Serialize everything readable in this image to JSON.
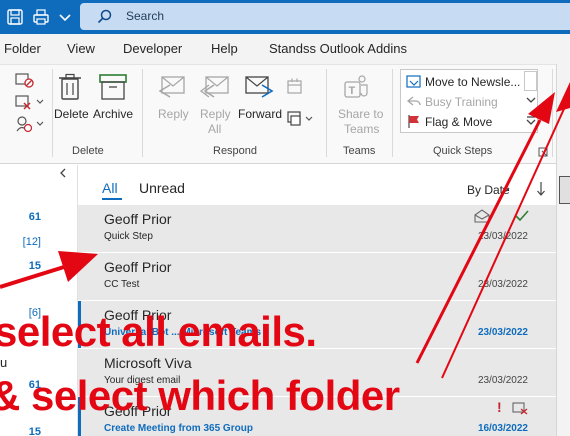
{
  "search": {
    "placeholder": "Search"
  },
  "menu": [
    "Folder",
    "View",
    "Developer",
    "Help",
    "Standss Outlook Addins"
  ],
  "ribbon": {
    "delete_group": {
      "label": "Delete",
      "delete": "Delete",
      "archive": "Archive"
    },
    "respond_group": {
      "label": "Respond",
      "reply": "Reply",
      "reply_all_1": "Reply",
      "reply_all_2": "All",
      "forward": "Forward"
    },
    "teams_group": {
      "label": "Teams",
      "share_1": "Share to",
      "share_2": "Teams"
    },
    "quicksteps_group": {
      "label": "Quick Steps",
      "items": [
        "Move to Newsle...",
        "Busy Training",
        "Flag & Move"
      ]
    }
  },
  "folders": {
    "counts": [
      "61",
      "[12]",
      "15",
      "[6]",
      "u",
      "61",
      "15"
    ]
  },
  "list": {
    "tabs": [
      "All",
      "Unread"
    ],
    "sort": "By Date",
    "messages": [
      {
        "from": "Geoff Prior",
        "subject": "Quick Step",
        "date": "23/03/2022"
      },
      {
        "from": "Geoff Prior",
        "subject": "CC Test",
        "date": "23/03/2022"
      },
      {
        "from": "Geoff Prior",
        "subject": "Universal Bot ... Microsoft Teams",
        "date": "23/03/2022"
      },
      {
        "from": "Microsoft Viva",
        "subject": "Your digest email",
        "date": "23/03/2022"
      },
      {
        "from": "Geoff Prior",
        "subject": "Create Meeting from 365 Group",
        "date": "16/03/2022"
      }
    ]
  },
  "annotations": {
    "line1": "select all emails.",
    "line2": "& select which folder"
  },
  "colors": {
    "accent": "#0f6cbd",
    "annotation": "#e30613",
    "titlebar": "#0f6cbd"
  }
}
